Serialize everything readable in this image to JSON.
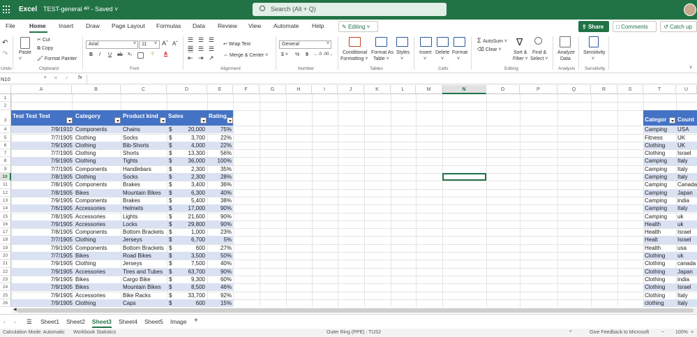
{
  "titlebar": {
    "app_name": "Excel",
    "doc_name": "TEST-general ᴬᴿ - Saved ˅",
    "search_placeholder": "Search (Alt + Q)"
  },
  "menus": [
    "File",
    "Home",
    "Insert",
    "Draw",
    "Page Layout",
    "Formulas",
    "Data",
    "Review",
    "View",
    "Automate",
    "Help"
  ],
  "mode": "Editing ˅",
  "buttons": {
    "share": "Share",
    "comments": "Comments",
    "catchup": "Catch up"
  },
  "ribbon": {
    "undo": "Undo",
    "paste": "Paste",
    "cut": "Cut",
    "copy": "Copy",
    "format_painter": "Format Painter",
    "clipboard": "Clipboard",
    "font_name": "Arial",
    "font_size": "11",
    "bold": "B",
    "italic": "I",
    "underline": "U",
    "font": "Font",
    "wrap_text": "Wrap Text",
    "merge_center": "Merge & Center ˅",
    "alignment": "Alignment",
    "number_format": "General",
    "currency": "$ ˅",
    "percent": "%",
    "comma": "9",
    "number": "Number",
    "cond_fmt": "Conditional",
    "cond_fmt2": "Formatting ˅",
    "format_table": "Format As",
    "format_table2": "Table ˅",
    "styles": "Styles",
    "styles2": "˅",
    "tables": "Tables",
    "insert": "Insert",
    "delete": "Delete",
    "format": "Format",
    "cells": "Cells",
    "autosum": "AutoSum ˅",
    "clear": "Clear ˅",
    "sort": "Sort &",
    "sort2": "Filter ˅",
    "find": "Find &",
    "find2": "Select ˅",
    "editing": "Editing",
    "analyze": "Analyze",
    "analyze2": "Data",
    "analysis": "Analysis",
    "sensitivity": "Sensitivity",
    "sensitivity_grp": "Sensitivity"
  },
  "formula": {
    "namebox": "N10",
    "fx": "fx"
  },
  "columns": [
    "A",
    "B",
    "C",
    "D",
    "E",
    "F",
    "G",
    "H",
    "I",
    "J",
    "K",
    "L",
    "M",
    "N",
    "O",
    "P",
    "Q",
    "R",
    "S",
    "T",
    "U"
  ],
  "rows": [
    "1",
    "2",
    "3",
    "4",
    "5",
    "6",
    "7",
    "8",
    "9",
    "10",
    "11",
    "12",
    "13",
    "14",
    "15",
    "16",
    "17",
    "18",
    "19",
    "20",
    "21",
    "22",
    "23",
    "24",
    "25",
    "26"
  ],
  "table1": {
    "headers": [
      "Test Test Test",
      "Category",
      "Product kind",
      "Sales",
      "Rating"
    ],
    "rows": [
      [
        "7/9/1910",
        "Components",
        "Chains",
        "$",
        "20,000",
        "75%"
      ],
      [
        "7/7/1905",
        "Clothing",
        "Socks",
        "$",
        "3,700",
        "22%"
      ],
      [
        "7/9/1905",
        "Clothing",
        "Bib-Shorts",
        "$",
        "4,000",
        "22%"
      ],
      [
        "7/7/1905",
        "Clothing",
        "Shorts",
        "$",
        "13,300",
        "56%"
      ],
      [
        "7/9/1905",
        "Clothing",
        "Tights",
        "$",
        "36,000",
        "100%"
      ],
      [
        "7/7/1905",
        "Components",
        "Handlebars",
        "$",
        "2,300",
        "35%"
      ],
      [
        "7/8/1905",
        "Clothing",
        "Socks",
        "$",
        "2,300",
        "28%"
      ],
      [
        "7/8/1905",
        "Components",
        "Brakes",
        "$",
        "3,400",
        "36%"
      ],
      [
        "7/8/1905",
        "Bikes",
        "Mountain Bikes",
        "$",
        "6,300",
        "40%"
      ],
      [
        "7/9/1905",
        "Components",
        "Brakes",
        "$",
        "5,400",
        "38%"
      ],
      [
        "7/6/1905",
        "Accessories",
        "Helmets",
        "$",
        "17,000",
        "90%"
      ],
      [
        "7/8/1905",
        "Accessories",
        "Lights",
        "$",
        "21,600",
        "90%"
      ],
      [
        "7/9/1905",
        "Accessories",
        "Locks",
        "$",
        "29,800",
        "90%"
      ],
      [
        "7/8/1905",
        "Components",
        "Bottom Brackets",
        "$",
        "1,000",
        "23%"
      ],
      [
        "7/7/1905",
        "Clothing",
        "Jerseys",
        "$",
        "6,700",
        "5%"
      ],
      [
        "7/9/1905",
        "Components",
        "Bottom Brackets",
        "$",
        "600",
        "27%"
      ],
      [
        "7/7/1905",
        "Bikes",
        "Road Bikes",
        "$",
        "3,500",
        "50%"
      ],
      [
        "7/9/1905",
        "Clothing",
        "Jerseys",
        "$",
        "7,500",
        "40%"
      ],
      [
        "7/9/1905",
        "Accessories",
        "Tires and Tubes",
        "$",
        "63,700",
        "90%"
      ],
      [
        "7/9/1905",
        "Bikes",
        "Cargo Bike",
        "$",
        "9,300",
        "60%"
      ],
      [
        "7/9/1905",
        "Bikes",
        "Mountain Bikes",
        "$",
        "8,500",
        "46%"
      ],
      [
        "7/9/1905",
        "Accessories",
        "Bike Racks",
        "$",
        "33,700",
        "92%"
      ],
      [
        "7/9/1905",
        "Clothing",
        "Caps",
        "$",
        "600",
        "15%"
      ]
    ]
  },
  "table2": {
    "headers": [
      "Categor",
      "Count"
    ],
    "rows": [
      [
        "Camping",
        "USA"
      ],
      [
        "Fitness",
        "UK"
      ],
      [
        "Clothing",
        "UK"
      ],
      [
        "Clothing",
        "Israel"
      ],
      [
        "Camping",
        "Italy"
      ],
      [
        "Camping",
        "Italy"
      ],
      [
        "Camping",
        "Italy"
      ],
      [
        "Camping",
        "Canada"
      ],
      [
        "Camping",
        "Japan"
      ],
      [
        "Camping",
        "india"
      ],
      [
        "Camping",
        "Italy"
      ],
      [
        "Camping",
        "uk"
      ],
      [
        "Health",
        "uk"
      ],
      [
        "Health",
        "Israel"
      ],
      [
        "Healt",
        "Israel"
      ],
      [
        "Health",
        "usa"
      ],
      [
        "Clothing",
        "uk"
      ],
      [
        "Clothing",
        "canada"
      ],
      [
        "Clothing",
        "Japan"
      ],
      [
        "Clothing",
        "india"
      ],
      [
        "Clothing",
        "Israel"
      ],
      [
        "Clothing",
        "Italy"
      ],
      [
        "clothing",
        "Italy"
      ]
    ]
  },
  "sheets": [
    "Sheet1",
    "Sheet2",
    "Sheet3",
    "Sheet4",
    "Sheet5",
    "Image"
  ],
  "active_sheet": "Sheet3",
  "status": {
    "calc": "Calculation Mode: Automatic",
    "stats": "Workbook Statistics",
    "ring": "Outer Ring (PPE) : TUS2",
    "feedback": "Give Feedback to Microsoft",
    "zoom": "100%",
    "zoom_minus": "−",
    "zoom_plus": "+"
  },
  "colors": {
    "brand": "#217346",
    "table_header": "#4472c4",
    "table_band": "#d9e1f2"
  }
}
